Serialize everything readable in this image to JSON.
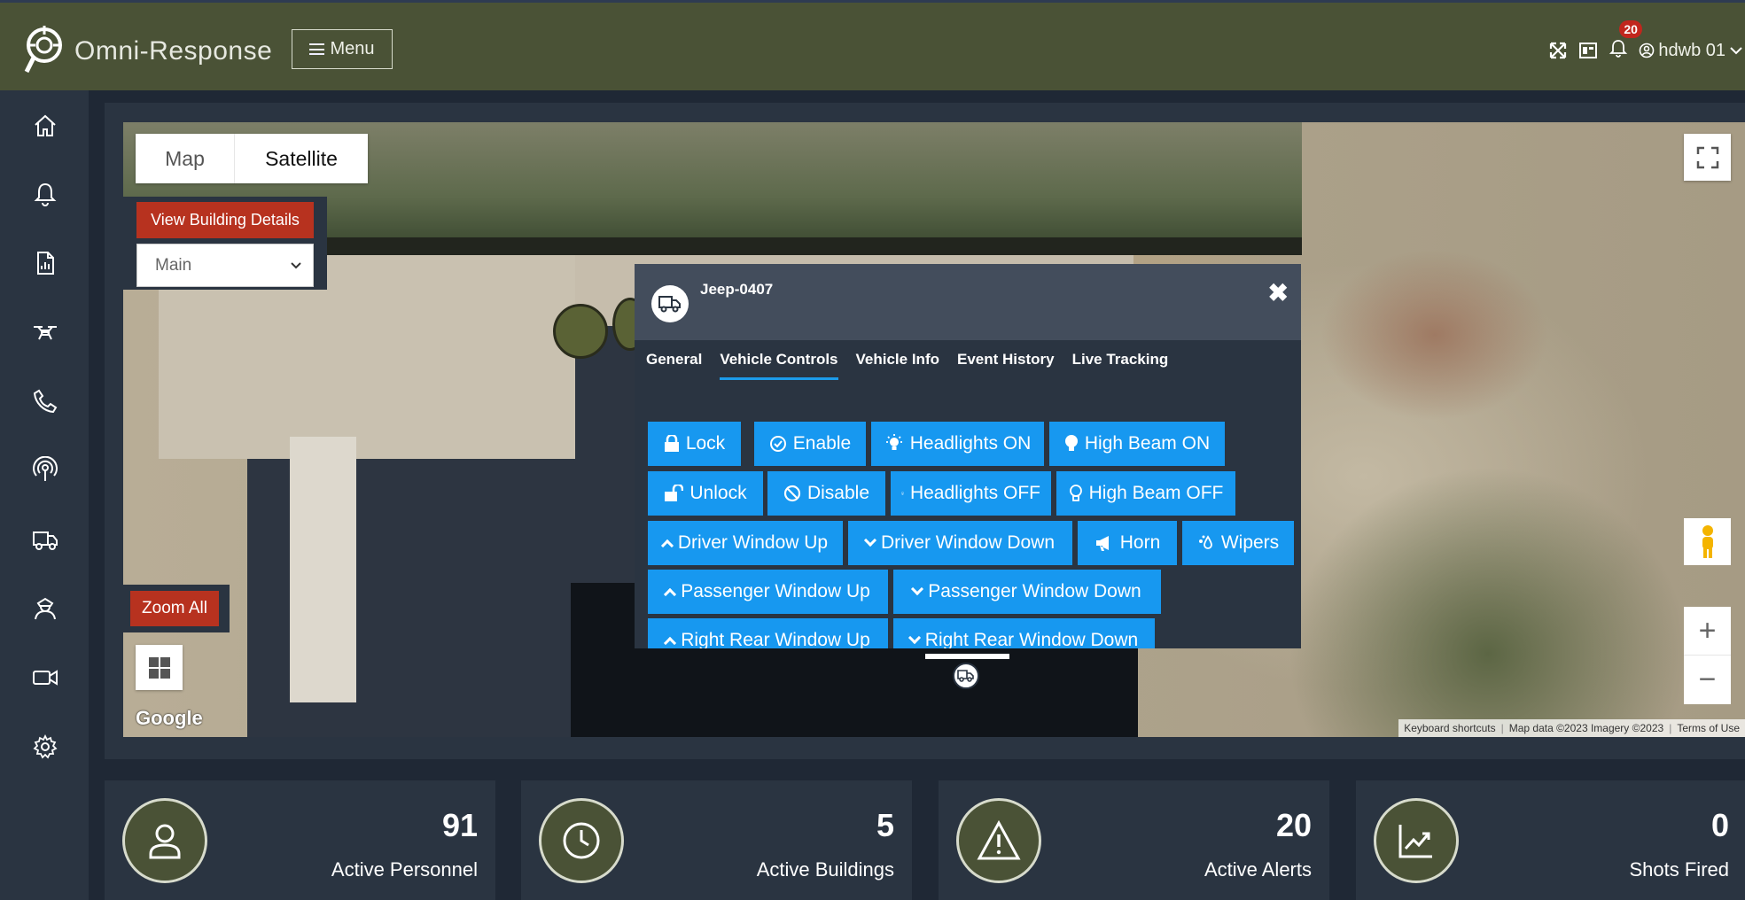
{
  "app": {
    "title": "Omni-Response",
    "menu_label": "Menu",
    "notification_count": "20",
    "user": "hdwb 01"
  },
  "sidebar": {
    "items": [
      "home-icon",
      "bell-icon",
      "report-icon",
      "drone-icon",
      "phone-icon",
      "broadcast-icon",
      "truck-icon",
      "officer-icon",
      "video-icon",
      "gear-icon"
    ]
  },
  "map": {
    "type_map": "Map",
    "type_satellite": "Satellite",
    "view_building_details": "View Building Details",
    "building_select": "Main",
    "zoom_all": "Zoom All",
    "google": "Google",
    "zoom_in": "+",
    "zoom_out": "−",
    "attribution": {
      "keyboard": "Keyboard shortcuts",
      "map_data": "Map data ©2023 Imagery ©2023",
      "terms": "Terms of Use"
    }
  },
  "popup": {
    "vehicle_name": "Jeep-0407",
    "close": "✖",
    "tabs": [
      "General",
      "Vehicle Controls",
      "Vehicle Info",
      "Event History",
      "Live Tracking"
    ],
    "active_tab": "Vehicle Controls",
    "controls": {
      "lock": "Lock",
      "enable": "Enable",
      "headlights_on": "Headlights ON",
      "high_beam_on": "High Beam ON",
      "unlock": "Unlock",
      "disable": "Disable",
      "headlights_off": "Headlights OFF",
      "high_beam_off": "High Beam OFF",
      "driver_window_up": "Driver Window Up",
      "driver_window_down": "Driver Window Down",
      "horn": "Horn",
      "wipers": "Wipers",
      "passenger_window_up": "Passenger Window Up",
      "passenger_window_down": "Passenger Window Down",
      "right_rear_window_up": "Right Rear Window Up",
      "right_rear_window_down": "Right Rear Window Down"
    }
  },
  "stats": [
    {
      "value": "91",
      "label": "Active Personnel",
      "icon": "person-icon"
    },
    {
      "value": "5",
      "label": "Active Buildings",
      "icon": "clock-icon"
    },
    {
      "value": "20",
      "label": "Active Alerts",
      "icon": "warning-icon"
    },
    {
      "value": "0",
      "label": "Shots Fired",
      "icon": "trend-icon"
    }
  ],
  "colors": {
    "topbar": "#4a5236",
    "sidebar": "#2a3441",
    "accent_blue": "#1798f0",
    "danger_red": "#b7321f",
    "badge_red": "#c1261d"
  }
}
